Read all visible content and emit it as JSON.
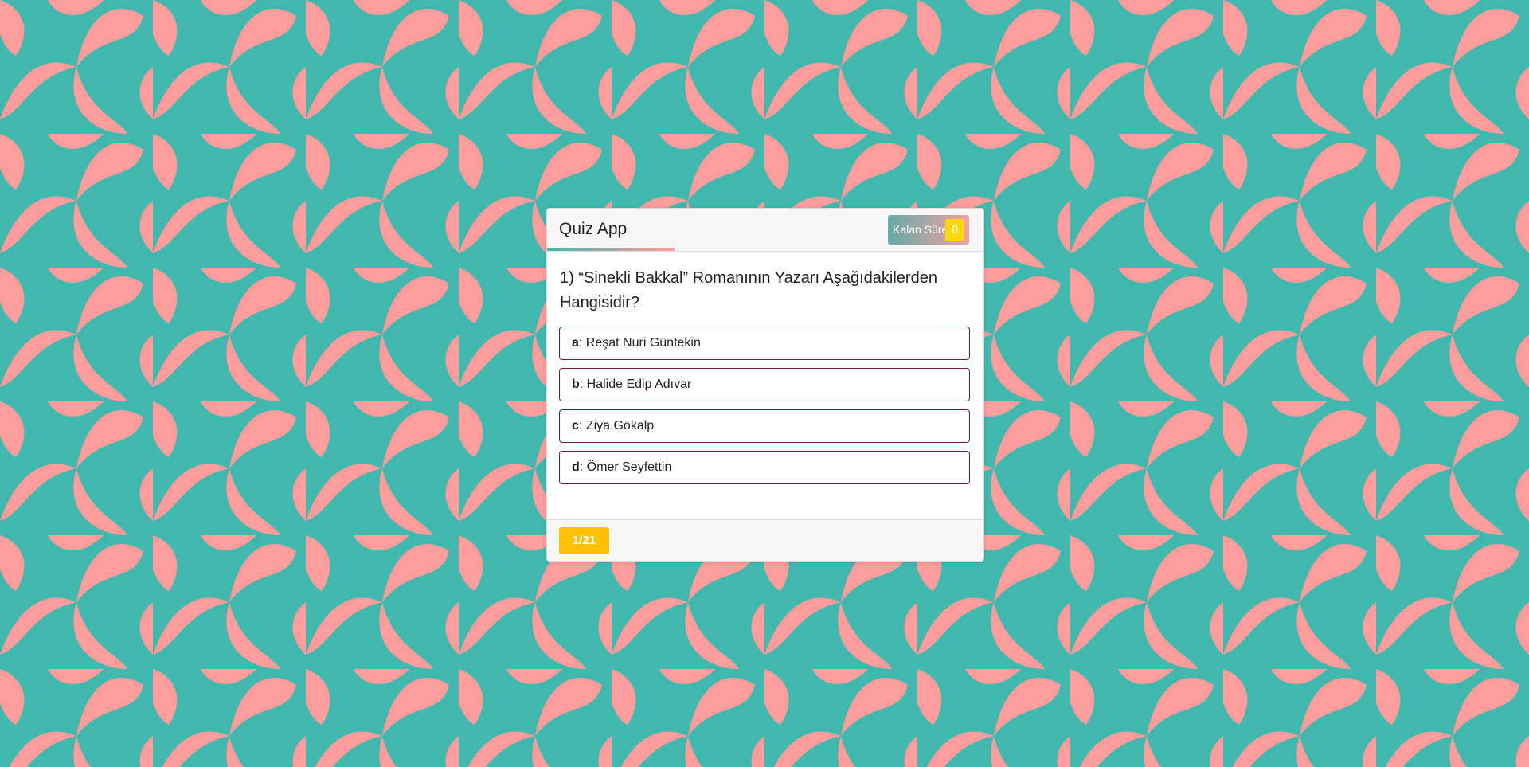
{
  "colors": {
    "background_teal": "#40b8ae",
    "background_pink": "#ff9c9c",
    "option_border": "#6b1a4a",
    "timer_badge": "#ffd700",
    "counter_badge": "#ffc107"
  },
  "header": {
    "title": "Quiz App",
    "timer_label": "Kalan Süre",
    "timer_seconds": "8"
  },
  "question": {
    "text": "1) “Sinekli Bakkal” Romanının Yazarı Aşağıdakilerden Hangisidir?"
  },
  "options": [
    {
      "key": "a",
      "label": "Reşat Nuri Güntekin"
    },
    {
      "key": "b",
      "label": "Halide Edip Adıvar"
    },
    {
      "key": "c",
      "label": "Ziya Gökalp"
    },
    {
      "key": "d",
      "label": "Ömer Seyfettin"
    }
  ],
  "footer": {
    "counter": "1/21"
  }
}
